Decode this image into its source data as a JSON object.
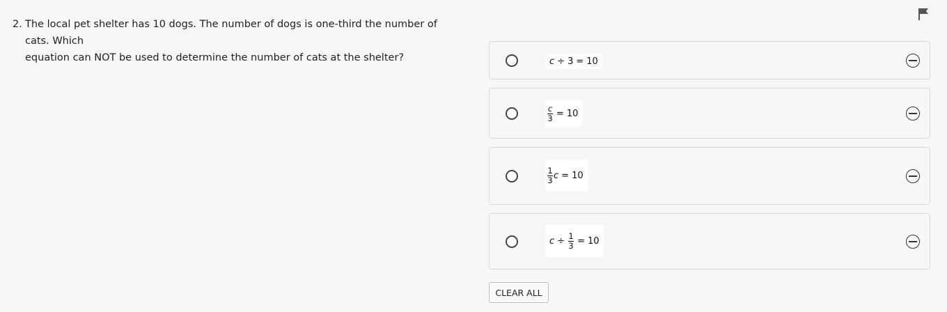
{
  "question": {
    "number": "2.",
    "line1": "The local pet shelter has 10 dogs. The number of dogs is one-third the number of",
    "line2": "cats. Which",
    "line3": "equation can NOT be used to determine the number of cats at the shelter?"
  },
  "flag": {
    "icon": "flag-icon"
  },
  "choices": [
    {
      "equation": "c ÷ 3 = 10",
      "parts": {
        "var": "c",
        "op": "÷",
        "num": "3",
        "eq": "=",
        "rhs": "10"
      }
    },
    {
      "equation": "c/3 = 10",
      "parts": {
        "numerator": "c",
        "denominator": "3",
        "eq": "=",
        "rhs": "10"
      }
    },
    {
      "equation": "1/3 c = 10",
      "parts": {
        "numerator": "1",
        "denominator": "3",
        "var": "c",
        "eq": "=",
        "rhs": "10"
      }
    },
    {
      "equation": "c ÷ 1/3 = 10",
      "parts": {
        "var": "c",
        "op": "÷",
        "numerator": "1",
        "denominator": "3",
        "eq": "=",
        "rhs": "10"
      }
    }
  ],
  "clear_all_label": "CLEAR ALL",
  "colors": {
    "background": "#f7f7f7",
    "border": "#d9d9d9",
    "text": "#222222"
  }
}
